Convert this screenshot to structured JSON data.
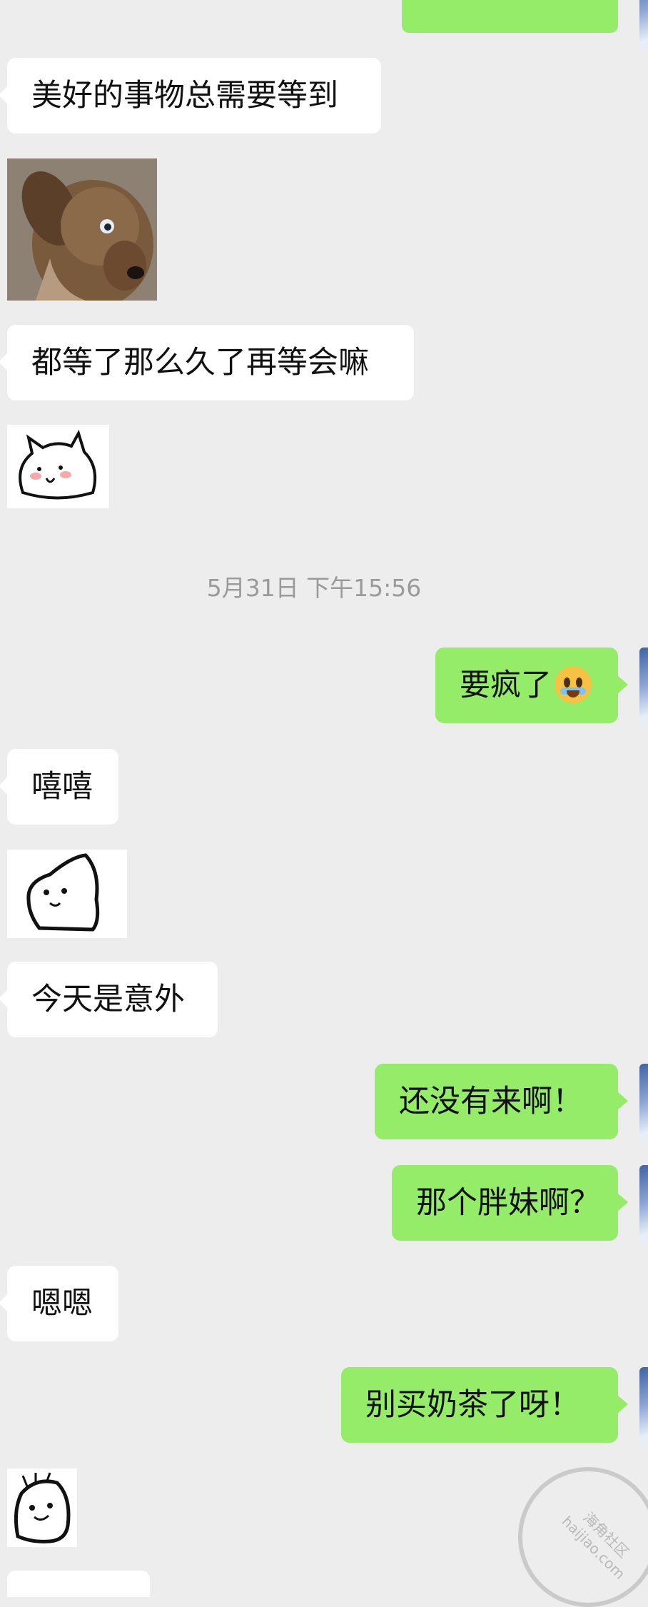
{
  "timestamp": "5月31日 下午15:56",
  "messages": {
    "m1": "美好的事物总需要等到",
    "m2": "都等了那么久了再等会嘛",
    "m3": "要疯了",
    "m4": "嘻嘻",
    "m5": "今天是意外",
    "m6": "还没有来啊！",
    "m7": "那个胖妹啊？",
    "m8": "嗯嗯",
    "m9": "别买奶茶了呀！"
  },
  "watermark": {
    "line1": "海角社区",
    "line2": "haijiao.com"
  },
  "colors": {
    "background": "#ededed",
    "incoming_bubble": "#ffffff",
    "outgoing_bubble": "#95ec69",
    "timestamp_text": "#9a9a9a"
  },
  "icons": {
    "dog_photo": "dog-photo",
    "sticker_bunny": "bunny-sticker",
    "sticker_peek": "peek-sticker",
    "sticker_blob": "blob-sticker",
    "emoji_cry": "crying-face-emoji"
  }
}
